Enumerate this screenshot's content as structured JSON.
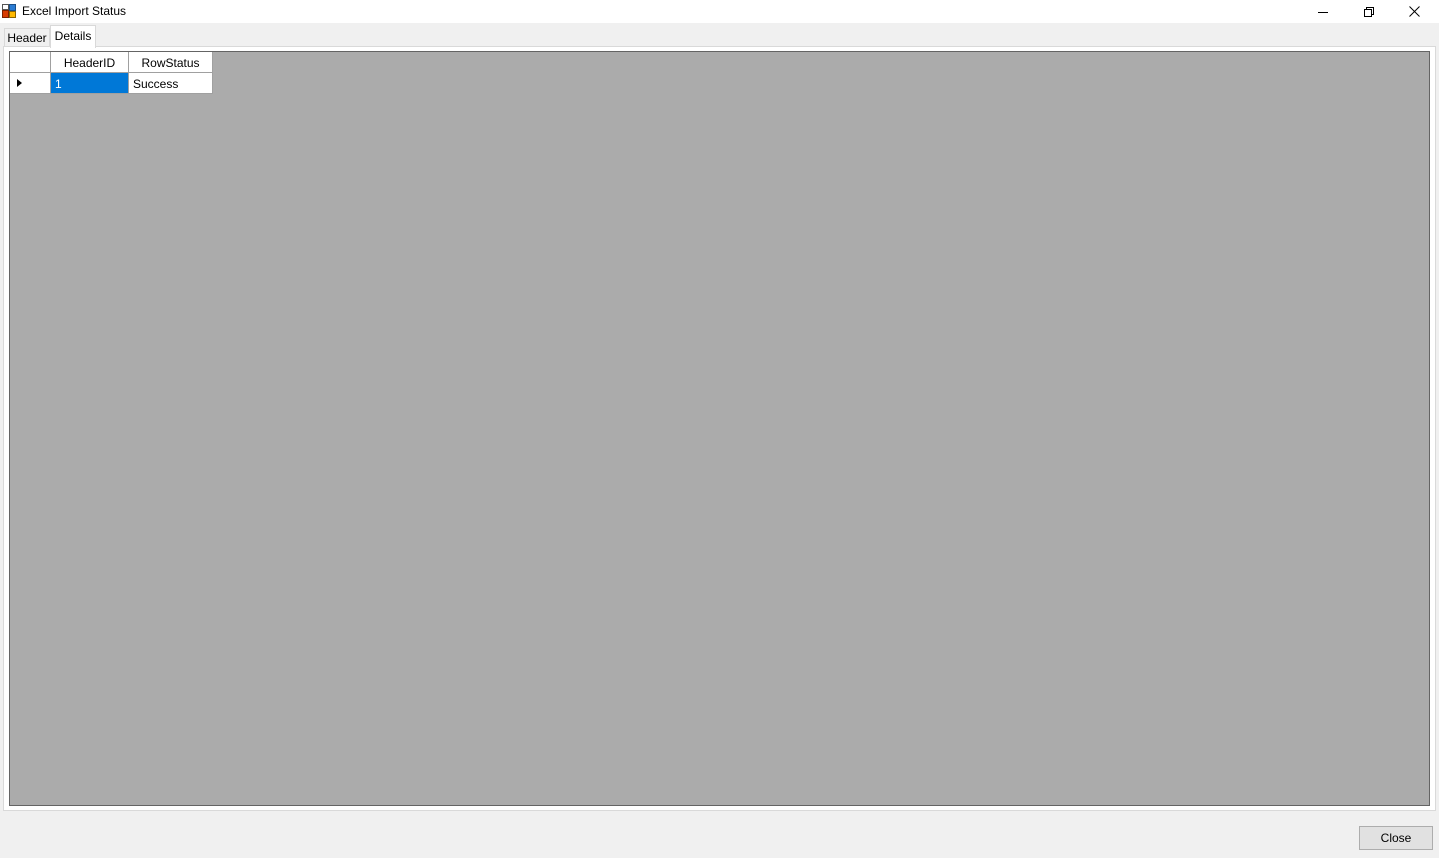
{
  "window": {
    "title": "Excel Import Status",
    "controls": {
      "minimize_icon": "minimize-icon",
      "restore_icon": "restore-icon",
      "close_icon": "close-icon"
    }
  },
  "tabs": [
    {
      "label": "Header",
      "selected": false
    },
    {
      "label": "Details",
      "selected": true
    }
  ],
  "grid": {
    "columns": [
      "HeaderID",
      "RowStatus"
    ],
    "rows": [
      {
        "HeaderID": "1",
        "RowStatus": "Success",
        "current": true
      }
    ]
  },
  "footer": {
    "close_label": "Close"
  },
  "colors": {
    "selection": "#0078d7",
    "grid_background": "#ababab",
    "window_background": "#f0f0f0"
  }
}
